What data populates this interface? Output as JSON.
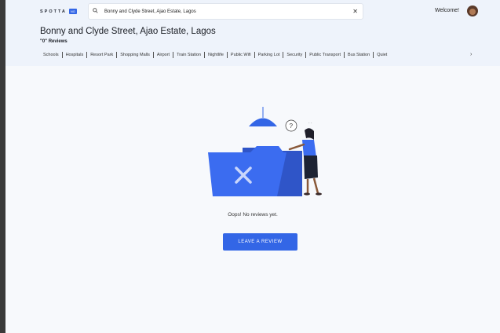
{
  "header": {
    "logo_text": "SPOTTA",
    "logo_badge": "NG",
    "search_value": "Bonny and Clyde Street, Ajao Estate, Lagos",
    "welcome": "Welcome!"
  },
  "location": {
    "title": "Bonny and Clyde Street, Ajao Estate, Lagos",
    "reviews_count": "\"0\" Reviews"
  },
  "amenities": [
    "Schools",
    "Hospitals",
    "Resort Park",
    "Shopping Malls",
    "Airport",
    "Train Station",
    "Nightlife",
    "Public Wifi",
    "Parking Lot",
    "Security",
    "Public Transport",
    "Bus Station",
    "Quiet"
  ],
  "empty_state": {
    "message": "Oops! No reviews yet.",
    "button_label": "LEAVE A REVIEW"
  },
  "colors": {
    "accent": "#3366e6",
    "background": "#f7f9fc",
    "header_bg": "#eef3fb"
  }
}
